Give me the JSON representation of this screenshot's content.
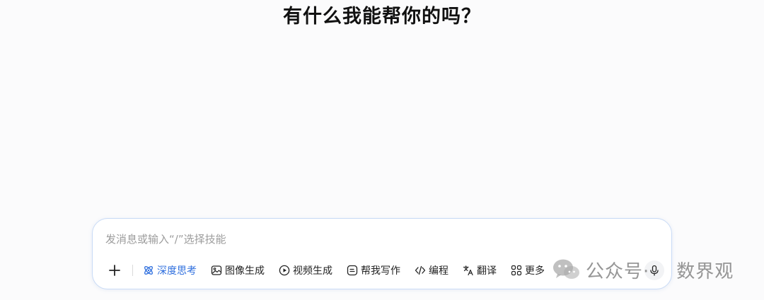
{
  "headline": "有什么我能帮你的吗？",
  "input": {
    "placeholder": "发消息或输入“/”选择技能",
    "value": ""
  },
  "toolbar": {
    "add_icon": "plus-icon",
    "skills": [
      {
        "label": "深度思考",
        "icon": "atom-icon",
        "active": true
      },
      {
        "label": "图像生成",
        "icon": "image-icon",
        "active": false
      },
      {
        "label": "视频生成",
        "icon": "play-icon",
        "active": false
      },
      {
        "label": "帮我写作",
        "icon": "doc-icon",
        "active": false
      },
      {
        "label": "编程",
        "icon": "code-icon",
        "active": false
      },
      {
        "label": "翻译",
        "icon": "translate-icon",
        "active": false
      },
      {
        "label": "更多",
        "icon": "grid-icon",
        "active": false
      }
    ],
    "mic_icon": "microphone-icon"
  },
  "watermark": {
    "left_text": "公众号·",
    "right_text": "数界观",
    "logo_icon": "wechat-logo-icon"
  },
  "colors": {
    "accent": "#2f6fde",
    "border": "#c9dbf6",
    "background": "#fbfbfc"
  }
}
